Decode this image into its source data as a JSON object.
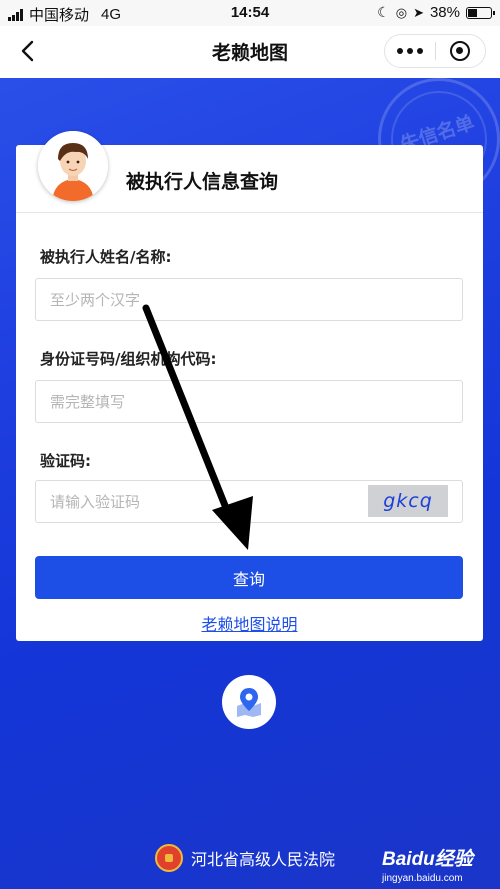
{
  "status_bar": {
    "carrier": "中国移动",
    "network": "4G",
    "time": "14:54",
    "battery": "38%"
  },
  "nav": {
    "title": "老赖地图"
  },
  "stamp_text": "失信名单",
  "card": {
    "title": "被执行人信息查询",
    "name_label": "被执行人姓名/名称:",
    "name_placeholder": "至少两个汉字",
    "id_label": "身份证号码/组织机构代码:",
    "id_placeholder": "需完整填写",
    "captcha_label": "验证码:",
    "captcha_placeholder": "请输入验证码",
    "captcha_code": "gkcq",
    "query_button": "查询",
    "help_link": "老赖地图说明"
  },
  "footer": {
    "court_name": "河北省高级人民法院"
  },
  "watermark": {
    "brand": "Baidu经验",
    "url": "jingyan.baidu.com"
  },
  "colors": {
    "primary": "#1d4fe6",
    "background": "#1f3fe0",
    "annotation_arrow": "#000000"
  }
}
